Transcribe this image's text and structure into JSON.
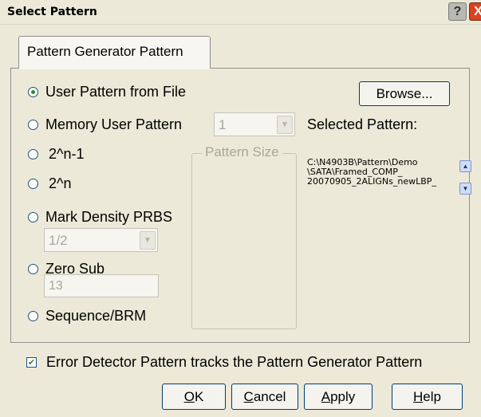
{
  "dialog": {
    "title": "Select Pattern",
    "help_glyph": "?",
    "close_glyph": "X"
  },
  "tab": {
    "label": "Pattern Generator Pattern"
  },
  "options": {
    "user_pattern_from_file": "User Pattern from File",
    "memory_user_pattern": "Memory User Pattern",
    "two_n_minus_1": "2^n-1",
    "two_n": "2^n",
    "mark_density_prbs": "Mark Density PRBS",
    "zero_sub": "Zero Sub",
    "sequence_brm": "Sequence/BRM",
    "selected": "user_pattern_from_file"
  },
  "memory_user_pattern_select": {
    "value": "1"
  },
  "mark_density_select": {
    "value": "1/2"
  },
  "zero_sub_field": {
    "value": "13"
  },
  "pattern_size_group": {
    "label": "Pattern Size"
  },
  "browse_button": {
    "label": "Browse..."
  },
  "selected_pattern": {
    "label": "Selected Pattern:",
    "path_lines": [
      "C:\\N4903B\\Pattern\\Demo",
      "\\SATA\\Framed_COMP_",
      "20070905_2ALIGNs_newLBP_"
    ]
  },
  "error_detector_tracks": {
    "label": "Error Detector Pattern tracks the Pattern Generator Pattern",
    "checked": true
  },
  "footer_buttons": {
    "ok": {
      "mnemonic": "O",
      "rest": "K"
    },
    "cancel": {
      "mnemonic": "C",
      "rest": "ancel"
    },
    "apply": {
      "mnemonic": "A",
      "rest": "pply"
    },
    "help": {
      "mnemonic": "H",
      "rest": "elp"
    }
  },
  "icons": {
    "scroll_up": "▲",
    "scroll_down": "▼",
    "dropdown": "▼",
    "check": "✔"
  }
}
